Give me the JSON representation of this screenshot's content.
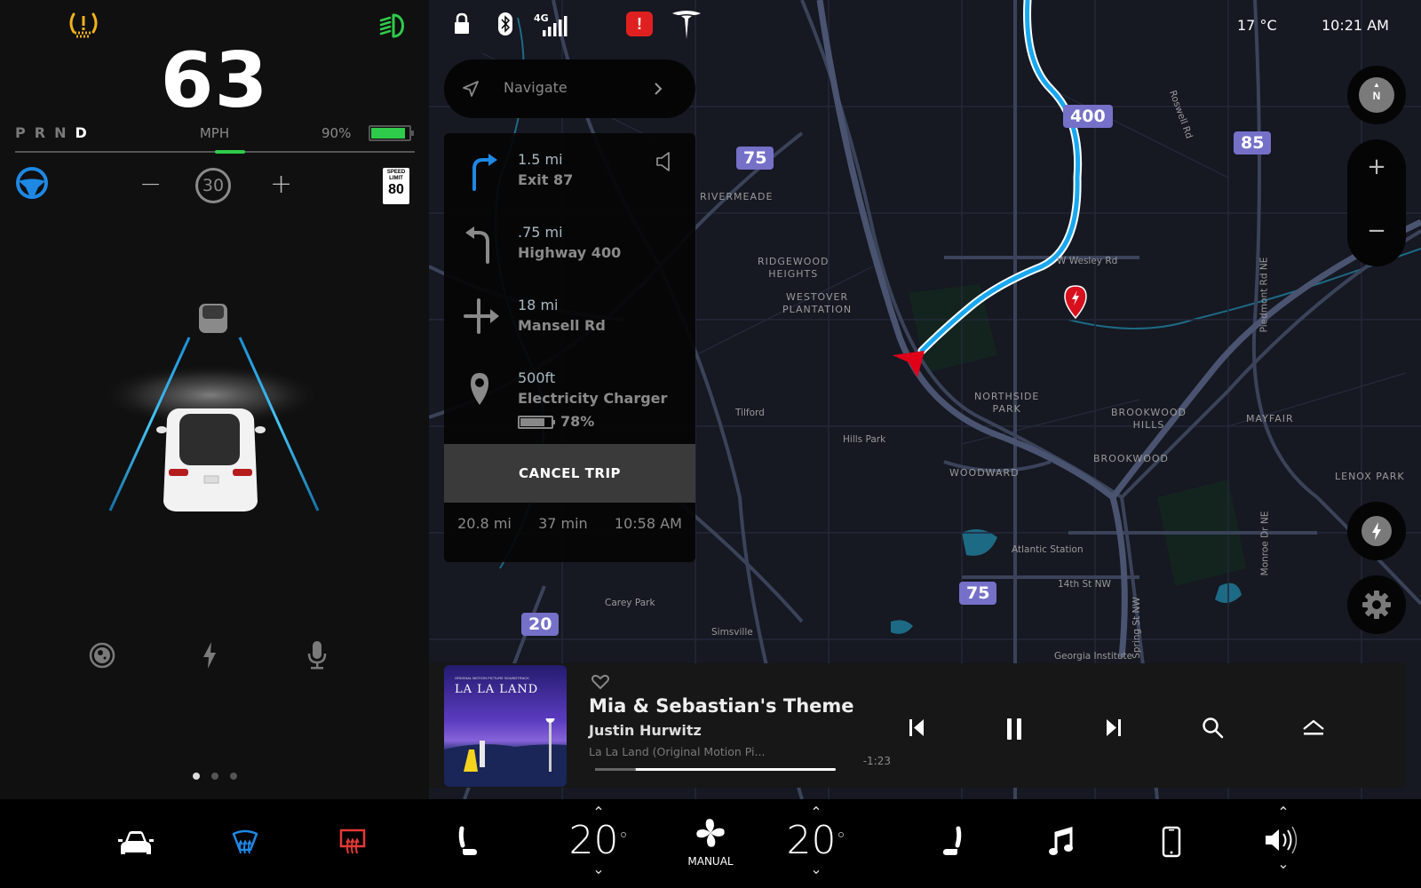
{
  "cluster": {
    "speed": "63",
    "speed_unit": "MPH",
    "gears": [
      "P",
      "R",
      "N",
      "D"
    ],
    "active_gear": "D",
    "battery_percent_label": "90%",
    "battery_level": 0.9,
    "cruise_speed": "30",
    "cruise_minus": "−",
    "cruise_plus": "+",
    "speed_limit_label": "SPEED LIMIT",
    "speed_limit_value": "80",
    "icons": {
      "tire_pressure": "tire-pressure-warning-icon",
      "headlights": "headlights-icon",
      "autopilot": "steering-wheel-icon",
      "dashcam": "dashcam-icon",
      "energy": "lightning-icon",
      "voice": "microphone-icon"
    },
    "page_dots": 3,
    "active_page": 0
  },
  "status_bar": {
    "icons": [
      "lock-icon",
      "bluetooth-icon",
      "4g-signal-icon",
      "alert-icon",
      "tesla-logo-icon"
    ],
    "network": "4G",
    "alert_symbol": "!",
    "temperature": "17 °C",
    "time": "10:21 AM"
  },
  "navigate": {
    "label": "Navigate"
  },
  "directions": {
    "steps": [
      {
        "distance": "1.5 mi",
        "name": "Exit 87",
        "icon": "turn-right-icon"
      },
      {
        "distance": ".75 mi",
        "name": "Highway 400",
        "icon": "turn-left-icon"
      },
      {
        "distance": "18 mi",
        "name": "Mansell Rd",
        "icon": "continue-straight-icon"
      },
      {
        "distance": "500ft",
        "name": "Electricity Charger",
        "icon": "location-pin-icon"
      }
    ],
    "charger_battery_label": "78%",
    "charger_battery_level": 0.78,
    "cancel_label": "CANCEL TRIP",
    "summary": {
      "distance": "20.8 mi",
      "duration": "37 min",
      "arrival": "10:58 AM"
    }
  },
  "map": {
    "shields": [
      "400",
      "75",
      "85",
      "75",
      "20"
    ],
    "labels": [
      "RIVERMEADE",
      "RIDGEWOOD\nHEIGHTS",
      "WESTOVER\nPLANTATION",
      "NORTHSIDE\nPARK",
      "BROOKWOOD\nHILLS",
      "BROOKWOOD",
      "MAYFAIR",
      "LENOX PARK",
      "WOODWARD",
      "Tilford",
      "Hills Park",
      "Carey Park",
      "Simsville",
      "Atlantic Station",
      "14th St NW",
      "Georgia Institute",
      "W Wesley Rd",
      "Roswell Rd",
      "Piedmont Rd NE",
      "Monroe Dr NE",
      "Spring St NW"
    ],
    "compass_label": "N",
    "zoom_in": "+",
    "zoom_out": "−"
  },
  "media": {
    "album_title": "LA LA LAND",
    "album_subtitle": "ORIGINAL MOTION PICTURE SOUNDTRACK",
    "track_title": "Mia & Sebastian's Theme",
    "artist": "Justin Hurwitz",
    "album": "La La Land (Original Motion Pi...",
    "remaining": "-1:23",
    "progress": 0.17
  },
  "bottom_bar": {
    "driver_temp": "20",
    "passenger_temp": "20",
    "degree_symbol": "°",
    "fan_mode": "MANUAL",
    "chevron_up": "^",
    "chevron_down": "v",
    "colors": {
      "front_defrost": "#1e88e5",
      "rear_defrost": "#e53935"
    }
  }
}
